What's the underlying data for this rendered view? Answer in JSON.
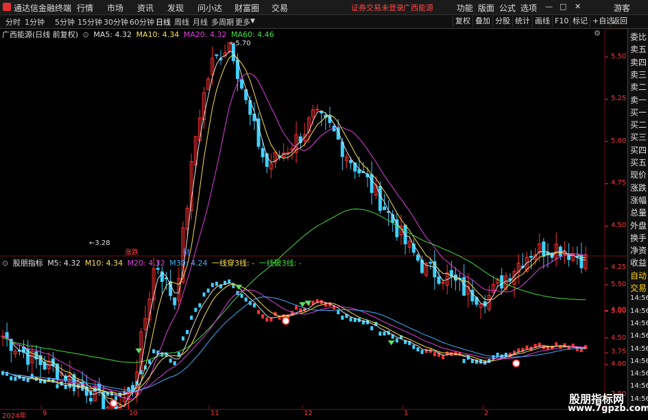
{
  "titlebar": {
    "app_name": "通达信金融终端",
    "menus": [
      "行情",
      "市场",
      "资讯",
      "发现",
      "问小达",
      "财富圈",
      "交易"
    ],
    "warning": "证券交易未登录",
    "stock": "广西能源",
    "right_menus": [
      "功能",
      "版面",
      "公式",
      "选项"
    ],
    "user": "游客",
    "window_controls": [
      "—",
      "□",
      "✕"
    ]
  },
  "toolbar": {
    "periods": [
      "分时",
      "1分钟",
      "5分钟",
      "15分钟",
      "30分钟",
      "60分钟",
      "日线",
      "周线",
      "月线",
      "多周期",
      "更多"
    ],
    "active_period": "日线",
    "right_buttons": [
      "复权",
      "叠加",
      "分股",
      "统计",
      "画线",
      "F10",
      "标记",
      "+自选",
      "返回"
    ]
  },
  "main_chart": {
    "title": "广西能源(日线 前复权)",
    "ma_legend": [
      {
        "text": "MA5: 4.32",
        "color": "#e0e0e0"
      },
      {
        "text": "MA10: 4.34",
        "color": "#ffe14a"
      },
      {
        "text": "MA20: 4.32",
        "color": "#e040e0"
      },
      {
        "text": "MA60: 4.46",
        "color": "#40e040"
      }
    ],
    "y_ticks": [
      "5.50",
      "5.25",
      "5.00",
      "4.75",
      "4.50",
      "4.25",
      "4.00",
      "3.75",
      "3.50"
    ],
    "high_label": "5.70",
    "low_label": "3.28",
    "tags": [
      {
        "text": "涨跌",
        "color": "#ff4040"
      },
      {
        "text": "财",
        "color": "#4a8cff"
      }
    ]
  },
  "indicator": {
    "title": "股朋指标",
    "legend": [
      {
        "text": "M5: 4.32",
        "color": "#e0e0e0"
      },
      {
        "text": "M10: 4.34",
        "color": "#ffe14a"
      },
      {
        "text": "M20: 4.32",
        "color": "#e040e0"
      },
      {
        "text": "M30: 4.24",
        "color": "#40b0ff"
      },
      {
        "text": "一线穿3线: -",
        "color": "#ffe14a"
      },
      {
        "text": "一线破3线: -",
        "color": "#40e040"
      }
    ],
    "y_ticks": [
      "5.50",
      "5.00",
      "4.50",
      "4.00"
    ]
  },
  "x_axis": {
    "labels": [
      "2024年",
      "9",
      "10",
      "11",
      "12",
      "1",
      "2"
    ]
  },
  "right_panel": {
    "items": [
      "委比",
      "卖五",
      "卖四",
      "卖三",
      "卖二",
      "卖一",
      "买一",
      "买二",
      "买三",
      "买四",
      "买五",
      "现价",
      "涨跌",
      "涨幅",
      "总量",
      "外盘",
      "换手",
      "净资",
      "收益",
      "自动",
      "交易",
      "14:56",
      "14:56",
      "14:56",
      "14:56",
      "14:56",
      "14:56",
      "14:56",
      "14:56",
      "14:56"
    ]
  },
  "watermark": {
    "line1": "股朋指标网",
    "line2": "www.7gpzb.com"
  },
  "colors": {
    "up": "#ff3030",
    "down": "#40d0ff",
    "ma5": "#e0e0e0",
    "ma10": "#ffe14a",
    "ma20": "#e040e0",
    "ma60": "#40e040",
    "m30": "#40b0ff"
  }
}
